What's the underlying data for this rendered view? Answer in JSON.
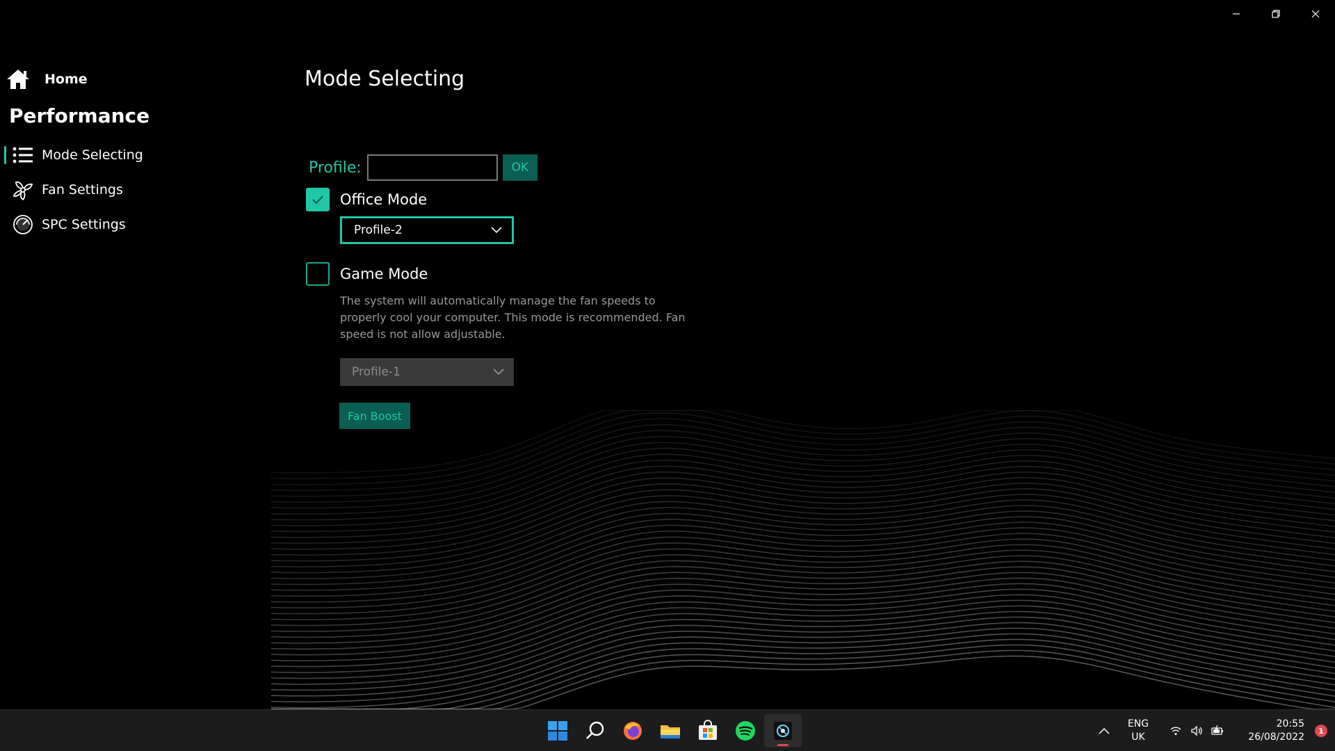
{
  "window": {
    "controls": [
      "minimize",
      "restore",
      "close"
    ]
  },
  "sidebar": {
    "home_label": "Home",
    "section_title": "Performance",
    "items": [
      {
        "label": "Mode Selecting",
        "icon": "list-icon",
        "active": true
      },
      {
        "label": "Fan Settings",
        "icon": "fan-icon",
        "active": false
      },
      {
        "label": "SPC Settings",
        "icon": "gauge-icon",
        "active": false
      }
    ]
  },
  "main": {
    "title": "Mode Selecting",
    "profile": {
      "label": "Profile:",
      "input_value": "",
      "ok_label": "OK"
    },
    "office_mode": {
      "label": "Office Mode",
      "checked": true,
      "selected_profile": "Profile-2"
    },
    "game_mode": {
      "label": "Game Mode",
      "checked": false,
      "description": "The system will automatically manage the fan speeds to properly cool your computer.  This mode is recommended. Fan speed is not allow adjustable.",
      "selected_profile": "Profile-1"
    },
    "fan_boost_label": "Fan Boost"
  },
  "taskbar": {
    "apps": [
      "windows-start-icon",
      "search-icon",
      "firefox-icon",
      "file-explorer-icon",
      "microsoft-store-icon",
      "spotify-icon",
      "control-center-icon"
    ],
    "language": {
      "line1": "ENG",
      "line2": "UK"
    },
    "clock": {
      "time": "20:55",
      "date": "26/08/2022"
    },
    "notification_count": "1"
  },
  "colors": {
    "accent": "#1fc7a8",
    "accent_dark": "#0a5e52",
    "background": "#000000",
    "taskbar": "#1c1c1c",
    "alert": "#e0484f"
  }
}
